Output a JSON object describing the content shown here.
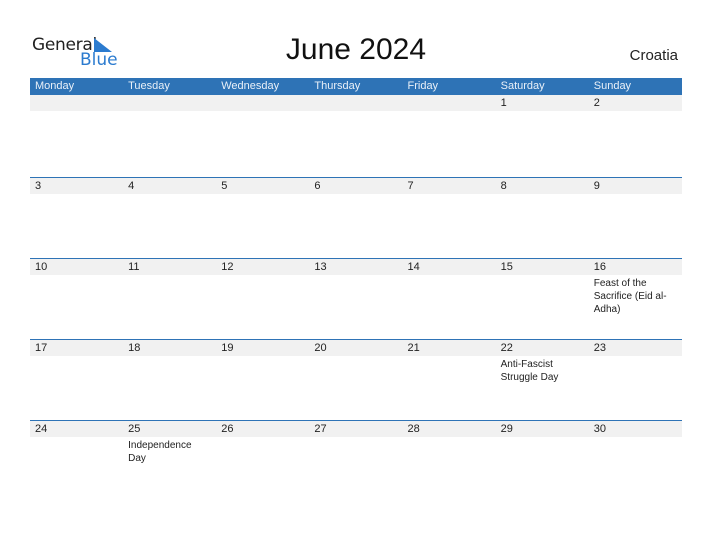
{
  "logo": {
    "word1": "General",
    "word2": "Blue",
    "color": "#2b7bcf"
  },
  "title": "June 2024",
  "country": "Croatia",
  "header_color": "#2e73b6",
  "weekdays": [
    "Monday",
    "Tuesday",
    "Wednesday",
    "Thursday",
    "Friday",
    "Saturday",
    "Sunday"
  ],
  "weeks": [
    [
      {
        "day": ""
      },
      {
        "day": ""
      },
      {
        "day": ""
      },
      {
        "day": ""
      },
      {
        "day": ""
      },
      {
        "day": "1"
      },
      {
        "day": "2"
      }
    ],
    [
      {
        "day": "3"
      },
      {
        "day": "4"
      },
      {
        "day": "5"
      },
      {
        "day": "6"
      },
      {
        "day": "7"
      },
      {
        "day": "8"
      },
      {
        "day": "9"
      }
    ],
    [
      {
        "day": "10"
      },
      {
        "day": "11"
      },
      {
        "day": "12"
      },
      {
        "day": "13"
      },
      {
        "day": "14"
      },
      {
        "day": "15"
      },
      {
        "day": "16",
        "holiday": "Feast of the Sacrifice (Eid al-Adha)"
      }
    ],
    [
      {
        "day": "17"
      },
      {
        "day": "18"
      },
      {
        "day": "19"
      },
      {
        "day": "20"
      },
      {
        "day": "21"
      },
      {
        "day": "22",
        "holiday": "Anti-Fascist Struggle Day"
      },
      {
        "day": "23"
      }
    ],
    [
      {
        "day": "24"
      },
      {
        "day": "25",
        "holiday": "Independence Day"
      },
      {
        "day": "26"
      },
      {
        "day": "27"
      },
      {
        "day": "28"
      },
      {
        "day": "29"
      },
      {
        "day": "30"
      }
    ]
  ]
}
